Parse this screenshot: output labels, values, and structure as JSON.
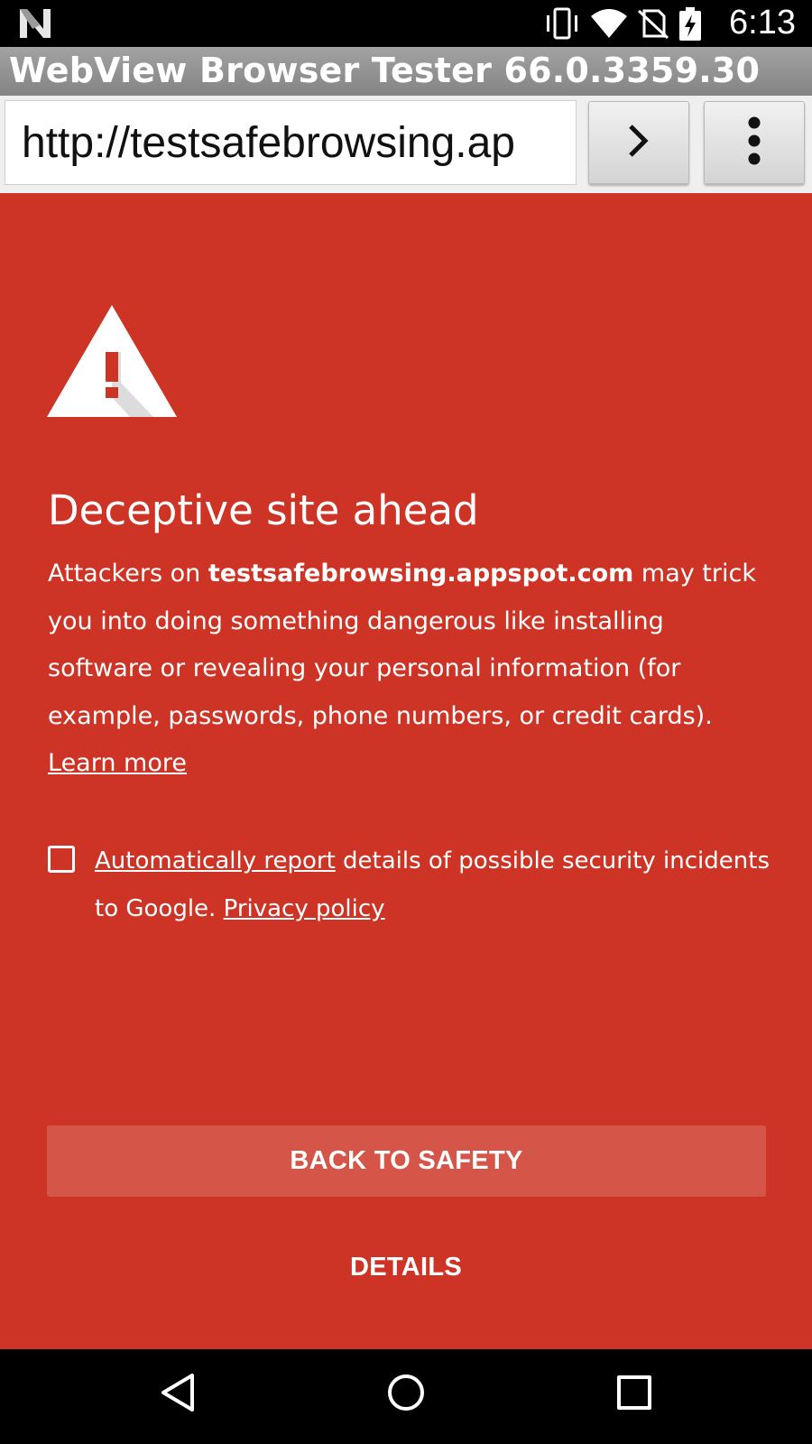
{
  "status_bar": {
    "time": "6:13",
    "icons": [
      "n-logo-icon",
      "vibrate-icon",
      "wifi-icon",
      "no-sim-icon",
      "battery-charging-icon"
    ]
  },
  "app": {
    "title": "WebView Browser Tester 66.0.3359.30"
  },
  "url_bar": {
    "value": "http://testsafebrowsing.ap",
    "go_icon": "chevron-right-icon",
    "menu_icon": "more-vert-icon"
  },
  "interstitial": {
    "background_color": "#ce3426",
    "heading": "Deceptive site ahead",
    "body": {
      "prefix": "Attackers on ",
      "domain": "testsafebrowsing.appspot.com",
      "line1_suffix": " may trick",
      "line2": "you into doing something dangerous like installing",
      "line3": "software or revealing your personal information (for",
      "line4": "example, passwords, phone numbers, or credit cards)."
    },
    "learn_more": "Learn more",
    "report": {
      "checked": false,
      "link": "Automatically report",
      "text1": " details of possible security incidents",
      "text2": "to Google. ",
      "privacy_link": "Privacy policy"
    },
    "back_button": "BACK TO SAFETY",
    "details_button": "DETAILS"
  },
  "nav_bar": {
    "buttons": [
      "back-icon",
      "home-icon",
      "recents-icon"
    ]
  }
}
